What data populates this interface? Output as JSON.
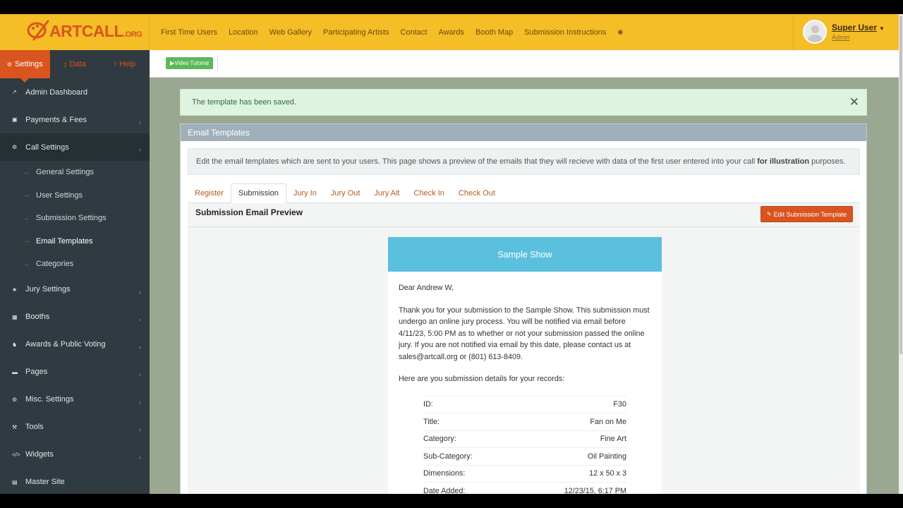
{
  "brand": {
    "logo_text": "ARTCALL",
    "logo_suffix": ".ORG",
    "colors": {
      "accent": "#d9541e",
      "topbar": "#f5bd26",
      "sidebar": "#2f3b40",
      "info": "#5bc0de",
      "success": "#5cb85c"
    }
  },
  "nav": {
    "items": [
      "First Time Users",
      "Location",
      "Web Gallery",
      "Participating Artists",
      "Contact",
      "Awards",
      "Booth Map",
      "Submission Instructions"
    ],
    "info_icon": "info-icon"
  },
  "user": {
    "name": "Super User",
    "role": "Admin"
  },
  "sidebar": {
    "tabs": [
      {
        "label": "Settings",
        "icon": "gear-icon"
      },
      {
        "label": "Data",
        "icon": "database-icon"
      },
      {
        "label": "Help",
        "icon": "question-icon"
      }
    ],
    "menu_top": [
      {
        "label": "Admin Dashboard",
        "icon": "chart-icon"
      },
      {
        "label": "Payments & Fees",
        "icon": "money-icon"
      },
      {
        "label": "Call Settings",
        "icon": "gear-icon"
      }
    ],
    "call_settings_sub": [
      "General Settings",
      "User Settings",
      "Submission Settings",
      "Email Templates",
      "Categories"
    ],
    "menu_bottom": [
      {
        "label": "Jury Settings",
        "icon": "star-icon"
      },
      {
        "label": "Booths",
        "icon": "booth-icon"
      },
      {
        "label": "Awards & Public Voting",
        "icon": "trophy-icon"
      },
      {
        "label": "Pages",
        "icon": "pages-icon"
      },
      {
        "label": "Misc. Settings",
        "icon": "cogs-icon"
      },
      {
        "label": "Tools",
        "icon": "wrench-icon"
      },
      {
        "label": "Widgets",
        "icon": "code-icon"
      },
      {
        "label": "Master Site",
        "icon": "building-icon"
      }
    ]
  },
  "toolbar": {
    "video_tutorial": "Video Tutorial"
  },
  "alert": {
    "message": "The template has been saved."
  },
  "panel": {
    "title": "Email Templates",
    "info_pre": "Edit the email templates which are sent to your users. This page shows a preview of the emails that they will recieve with data of the first user entered into your call",
    "info_bold": "for illustration",
    "info_post": "purposes.",
    "tabs": [
      "Register",
      "Submission",
      "Jury In",
      "Jury Out",
      "Jury Alt",
      "Check In",
      "Check Out"
    ],
    "preview_title": "Submission Email Preview",
    "edit_button": "Edit Submission Template"
  },
  "email": {
    "show_name": "Sample Show",
    "greeting": "Dear Andrew W,",
    "paragraph": "Thank you for your submission to the Sample Show. This submission must undergo an online jury process. You will be notified via email before 4/11/23, 5:00 PM as to whether or not your submission passed the online jury. If you are not notified via email by this date, please contact us at sales@artcall.org or (801) 613-8409.",
    "details_intro": "Here are you submission details for your records:",
    "details": [
      {
        "label": "ID:",
        "value": "F30"
      },
      {
        "label": "Title:",
        "value": "Fan on Me"
      },
      {
        "label": "Category:",
        "value": "Fine Art"
      },
      {
        "label": "Sub-Category:",
        "value": "Oil Painting"
      },
      {
        "label": "Dimensions:",
        "value": "12 x 50 x 3"
      },
      {
        "label": "Date Added:",
        "value": "12/23/15, 6:17 PM"
      }
    ]
  }
}
